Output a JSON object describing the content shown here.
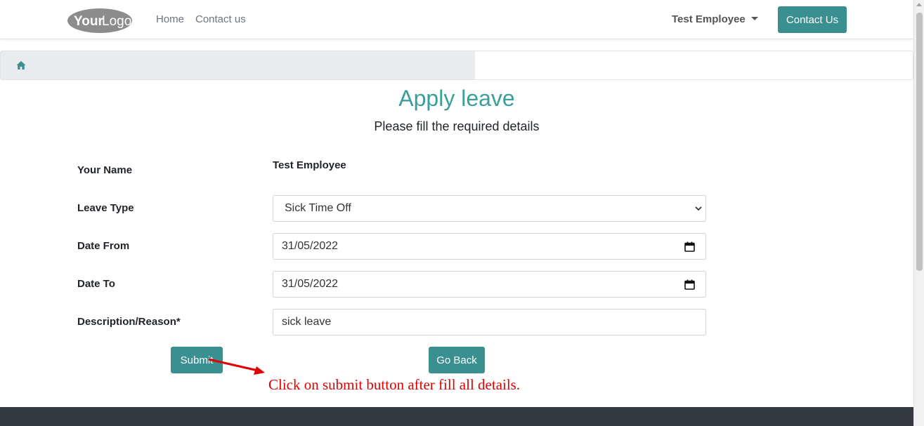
{
  "navbar": {
    "logo_text_a": "Your",
    "logo_text_b": "Logo",
    "links": [
      "Home",
      "Contact us"
    ],
    "user": "Test Employee",
    "contact_button": "Contact Us"
  },
  "breadcrumb": {
    "icon": "home-icon"
  },
  "page": {
    "title": "Apply leave",
    "subtitle": "Please fill the required details"
  },
  "form": {
    "name_label": "Your Name",
    "name_value": "Test Employee",
    "leave_type_label": "Leave Type",
    "leave_type_value": "Sick Time Off",
    "date_from_label": "Date From",
    "date_from_value": "31/05/2022",
    "date_to_label": "Date To",
    "date_to_value": "31/05/2022",
    "description_label": "Description/Reason*",
    "description_value": "sick leave",
    "submit_label": "Submit",
    "back_label": "Go Back"
  },
  "annotation": {
    "text": "Click on submit button after fill all details.",
    "color": "#e00000"
  },
  "colors": {
    "accent": "#3a8f91",
    "title": "#3a9e9a",
    "footer": "#343a40"
  }
}
